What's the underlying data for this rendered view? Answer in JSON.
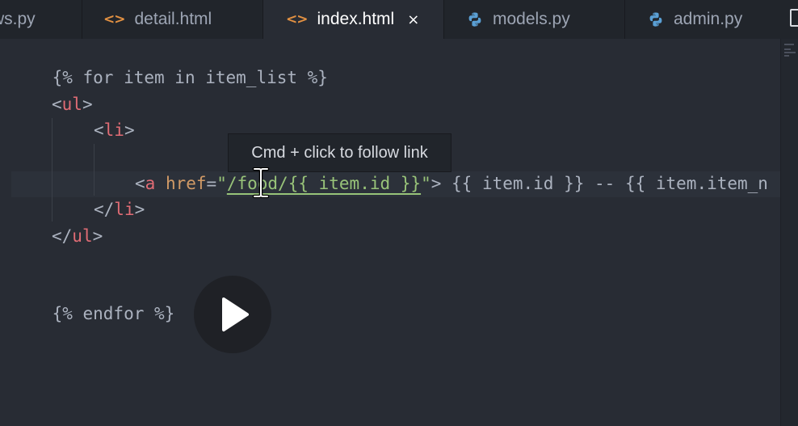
{
  "tabs": [
    {
      "label": "ws.py",
      "icon": "python-icon",
      "active": false
    },
    {
      "label": "detail.html",
      "icon": "html-icon",
      "active": false
    },
    {
      "label": "index.html",
      "icon": "html-icon",
      "active": true,
      "close": "×"
    },
    {
      "label": "models.py",
      "icon": "python-icon",
      "active": false
    },
    {
      "label": "admin.py",
      "icon": "python-icon",
      "active": false
    }
  ],
  "icons": {
    "html": "<>"
  },
  "code": {
    "line1": "{% for item in item_list %}",
    "line2_open": "<",
    "line2_tag": "ul",
    "line2_close": ">",
    "line3_open": "<",
    "line3_tag": "li",
    "line3_close": ">",
    "line4_open": "<",
    "line4_tag": "a",
    "line4_attr": " href",
    "line4_eq": "=",
    "line4_quote_open": "\"",
    "line4_link": "/food/{{ item.id }}",
    "line4_quote_close": "\"",
    "line4_tag_close": ">",
    "line4_rest": " {{ item.id }} -- {{ item.item_n",
    "line5_open": "</",
    "line5_tag": "li",
    "line5_close": ">",
    "line6_open": "</",
    "line6_tag": "ul",
    "line6_close": ">",
    "line7": "{% endfor %}"
  },
  "tooltip": {
    "text": "Cmd + click to follow link"
  },
  "colors": {
    "tag": "#e06c75",
    "attribute": "#d19a66",
    "string": "#98c379",
    "text": "#abb2bf",
    "html_icon": "#e39142",
    "python_icon": "#5a9fd4"
  }
}
